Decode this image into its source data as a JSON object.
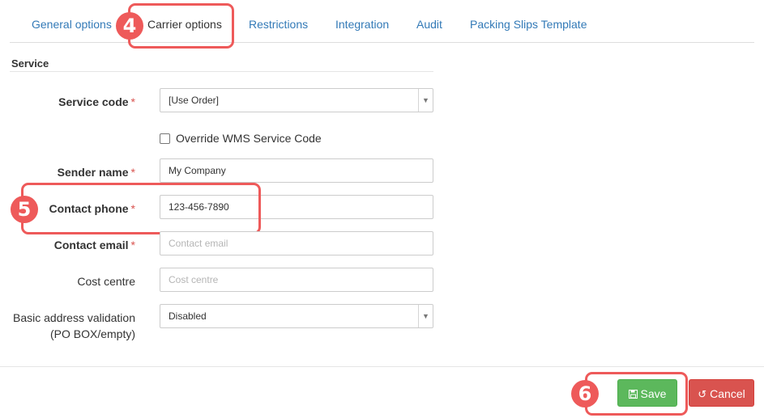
{
  "tabs": [
    {
      "label": "General options"
    },
    {
      "label": "Carrier options"
    },
    {
      "label": "Restrictions"
    },
    {
      "label": "Integration"
    },
    {
      "label": "Audit"
    },
    {
      "label": "Packing Slips Template"
    }
  ],
  "annotations": {
    "step_tab": "4",
    "step_phone": "5",
    "step_save": "6"
  },
  "section": {
    "title": "Service"
  },
  "form": {
    "service_code": {
      "label": "Service code",
      "required": "*",
      "value": "[Use Order]"
    },
    "override": {
      "label": "Override WMS Service Code",
      "checked": false
    },
    "sender_name": {
      "label": "Sender name",
      "required": "*",
      "value": "My Company"
    },
    "contact_phone": {
      "label": "Contact phone",
      "required": "*",
      "value": "123-456-7890"
    },
    "contact_email": {
      "label": "Contact email",
      "required": "*",
      "placeholder": "Contact email"
    },
    "cost_centre": {
      "label": "Cost centre",
      "placeholder": "Cost centre"
    },
    "address_validation": {
      "label_line1": "Basic address validation",
      "label_line2": "(PO BOX/empty)",
      "value": "Disabled"
    }
  },
  "buttons": {
    "save": "Save",
    "cancel": "Cancel"
  },
  "colors": {
    "link": "#337ab7",
    "annotation": "#ee5a5a",
    "save": "#5cb85c",
    "cancel": "#d9534f"
  },
  "icons": {
    "save": "floppy-disk-icon",
    "cancel": "undo-icon",
    "select": "chevron-down-icon"
  }
}
